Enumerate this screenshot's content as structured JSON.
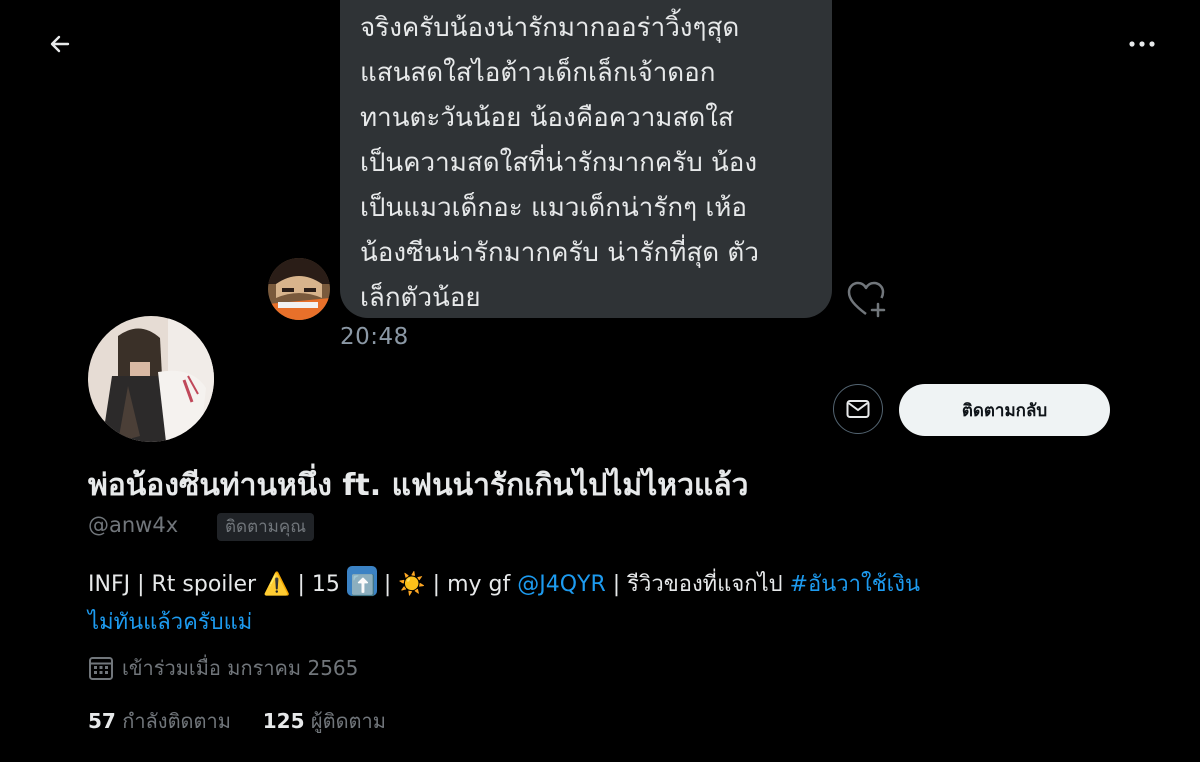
{
  "nav": {
    "back_icon": "arrow-left-icon",
    "more_icon": "more-horizontal-icon"
  },
  "message": {
    "lines": [
      "จริงครับน้องน่ารักมากออร่าวิ้งๆสุด",
      "แสนสดใสไอต้าวเด็กเล็กเจ้าดอก",
      "ทานตะวันน้อย น้องคือความสดใส",
      "เป็นความสดใสที่น่ารักมากครับ น้อง",
      "เป็นแมวเด็กอะ แมวเด็กน่ารักๆ เห้อ",
      "น้องซีนน่ารักมากครับ น่ารักที่สุด ตัว",
      "เล็กตัวน้อย"
    ],
    "time": "20:48",
    "react_icon": "heart-plus-icon",
    "bubble_color": "#2f3336"
  },
  "profile": {
    "display_name": "พ่อน้องซีนท่านหนึ่ง ft. แฟนน่ารักเกินไปไม่ไหวแล้ว",
    "handle": "@anw4x",
    "follows_you": "ติดตามคุณ",
    "follow_back_label": "ติดตามกลับ",
    "dm_icon": "envelope-icon",
    "bio": {
      "part1": "INFJ | Rt spoiler ",
      "warning_emoji": "⚠️",
      "part2": " | 15 ",
      "up_emoji": "⬆️",
      "part3": " | ",
      "sun_emoji": "☀️",
      "part4": " | my gf ",
      "mention": "@J4QYR",
      "part5": " | รีวิวของที่แจกไป ",
      "hashtag1": "#อันวาใช้เงิน",
      "hashtag2": "ไม่ทันแล้วครับแม่"
    },
    "joined_icon": "calendar-icon",
    "joined": "เข้าร่วมเมื่อ มกราคม 2565",
    "following_count": "57",
    "following_label": "กำลังติดตาม",
    "followers_count": "125",
    "followers_label": "ผู้ติดตาม"
  },
  "colors": {
    "background": "#000000",
    "link": "#1d9bf0",
    "muted": "#71767b",
    "text": "#e7e9ea"
  }
}
